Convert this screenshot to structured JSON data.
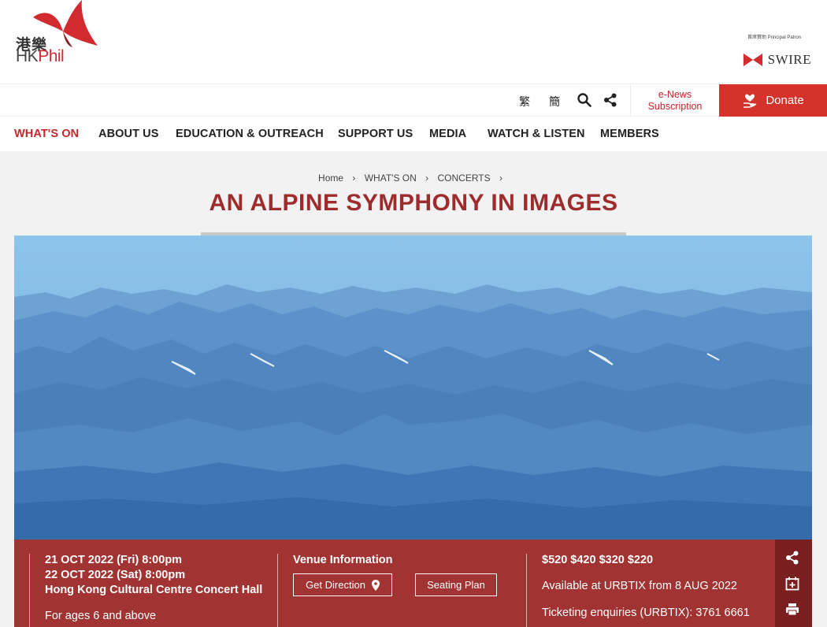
{
  "header": {
    "logo_cn": "港樂",
    "logo_en_hk": "HK",
    "logo_en_phil": "Phil",
    "patron_label": "首席贊助 Principal Patron",
    "sponsor_name": "SWIRE"
  },
  "utility": {
    "lang_trad": "繁",
    "lang_simp": "簡",
    "enews_line1": "e-News",
    "enews_line2": "Subscription",
    "donate_label": "Donate"
  },
  "nav": {
    "items": [
      "WHAT'S ON",
      "ABOUT US",
      "EDUCATION & OUTREACH",
      "SUPPORT US",
      "MEDIA",
      "WATCH & LISTEN",
      "MEMBERS"
    ]
  },
  "breadcrumb": [
    "Home",
    "WHAT'S ON",
    "CONCERTS"
  ],
  "page": {
    "title": "AN ALPINE SYMPHONY IN IMAGES"
  },
  "info": {
    "date1": "21 OCT 2022 (Fri) 8:00pm",
    "date2": "22 OCT 2022 (Sat) 8:00pm",
    "venue": "Hong Kong Cultural Centre Concert Hall",
    "ages": "For ages 6 and above",
    "venue_heading": "Venue Information",
    "direction_button": "Get Direction",
    "seating_button": "Seating Plan",
    "prices": "$520 $420 $320 $220",
    "availability": "Available at URBTIX from 8 AUG 2022",
    "enquiries": "Ticketing enquiries (URBTIX): 3761 6661"
  },
  "colors": {
    "brand_red": "#d5322b",
    "title_red": "#9e2c2c",
    "band_red": "#a13433",
    "side_dark": "#7a1f20"
  },
  "icons": [
    "search-icon",
    "share-icon",
    "heart-hand-icon",
    "map-pin-icon",
    "calendar-add-icon",
    "print-icon"
  ]
}
